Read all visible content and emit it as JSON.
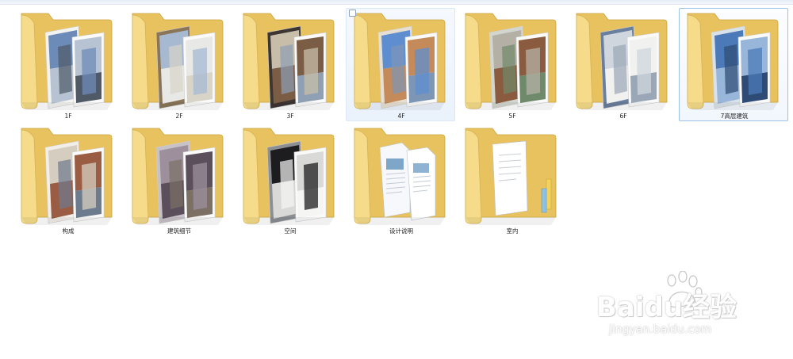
{
  "folders": [
    {
      "label": "1F",
      "icon": "folder-photo-icon"
    },
    {
      "label": "2F",
      "icon": "folder-photo-icon"
    },
    {
      "label": "3F",
      "icon": "folder-photo-icon"
    },
    {
      "label": "4F",
      "icon": "folder-photo-icon"
    },
    {
      "label": "5F",
      "icon": "folder-photo-icon"
    },
    {
      "label": "6F",
      "icon": "folder-photo-icon"
    },
    {
      "label": "7高层建筑",
      "icon": "folder-photo-icon"
    },
    {
      "label": "构成",
      "icon": "folder-photo-icon"
    },
    {
      "label": "建筑细节",
      "icon": "folder-photo-icon"
    },
    {
      "label": "空间",
      "icon": "folder-photo-icon"
    },
    {
      "label": "设计说明",
      "icon": "folder-document-icon"
    },
    {
      "label": "室内",
      "icon": "folder-document-icon"
    }
  ],
  "watermark": {
    "logo": "Baidu经验",
    "url": "jingyan.baidu.com"
  },
  "colors": {
    "folder_back": "#e8c25e",
    "folder_front": "#f6dc8a",
    "selection_border": "#9fc1e6",
    "hover_bg": "#eaf2fc"
  }
}
